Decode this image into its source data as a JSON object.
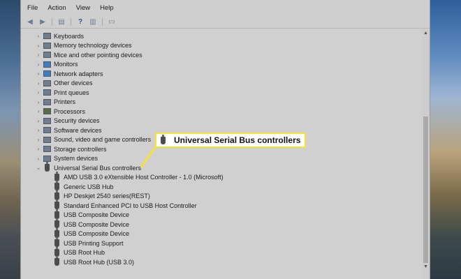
{
  "menubar": [
    "File",
    "Action",
    "View",
    "Help"
  ],
  "toolbar": [
    "back-icon",
    "forward-icon",
    "properties-icon",
    "help-icon",
    "view-icon",
    "monitor-icon"
  ],
  "tree": {
    "categories": [
      {
        "label": "Keyboards",
        "icon": "keyboard-icon"
      },
      {
        "label": "Memory technology devices",
        "icon": "memory-icon"
      },
      {
        "label": "Mice and other pointing devices",
        "icon": "mouse-icon"
      },
      {
        "label": "Monitors",
        "icon": "monitor-icon"
      },
      {
        "label": "Network adapters",
        "icon": "network-icon"
      },
      {
        "label": "Other devices",
        "icon": "unknown-device-icon"
      },
      {
        "label": "Print queues",
        "icon": "printer-icon"
      },
      {
        "label": "Printers",
        "icon": "printer-icon"
      },
      {
        "label": "Processors",
        "icon": "processor-icon"
      },
      {
        "label": "Security devices",
        "icon": "security-icon"
      },
      {
        "label": "Software devices",
        "icon": "software-icon"
      },
      {
        "label": "Sound, video and game controllers",
        "icon": "sound-icon"
      },
      {
        "label": "Storage controllers",
        "icon": "storage-icon"
      },
      {
        "label": "System devices",
        "icon": "system-icon"
      },
      {
        "label": "Universal Serial Bus controllers",
        "icon": "usb-icon"
      }
    ],
    "usb_children": [
      "AMD USB 3.0 eXtensible Host Controller - 1.0 (Microsoft)",
      "Generic USB Hub",
      "HP Deskjet 2540 series(REST)",
      "Standard Enhanced PCI to USB Host Controller",
      "USB Composite Device",
      "USB Composite Device",
      "USB Composite Device",
      "USB Printing Support",
      "USB Root Hub",
      "USB Root Hub (USB 3.0)"
    ]
  },
  "callout": {
    "label": "Universal Serial Bus controllers",
    "icon": "usb-icon"
  },
  "colors": {
    "callout_border": "#f5e13a",
    "background": "#d0d0d0"
  }
}
